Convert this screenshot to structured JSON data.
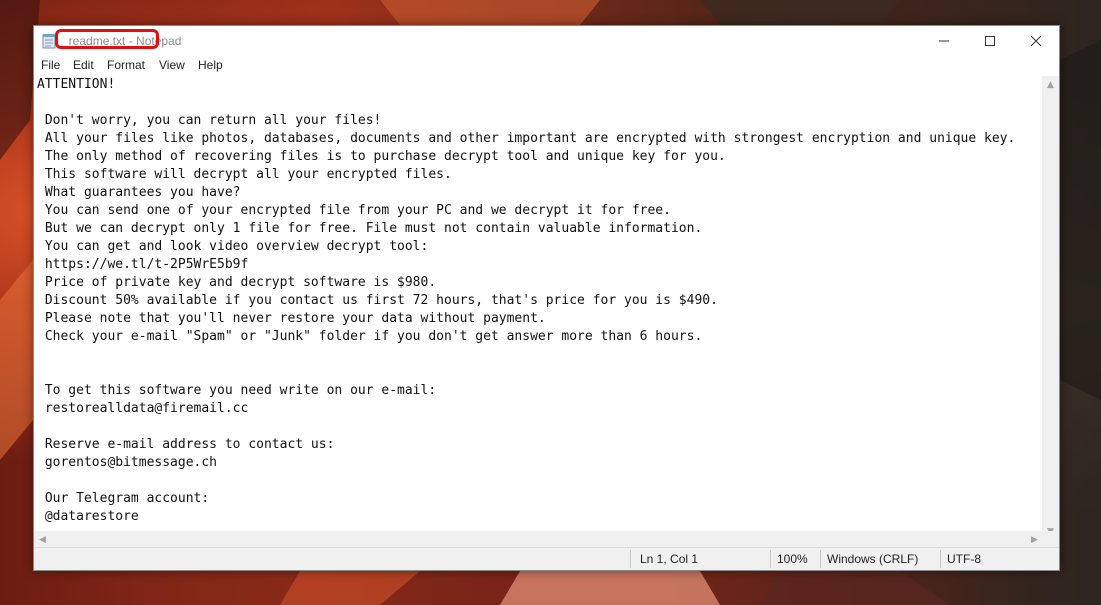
{
  "window": {
    "title": "_readme.txt - Notepad",
    "app_icon": "notepad-icon",
    "controls": [
      "minimize-icon",
      "maximize-icon",
      "close-icon"
    ]
  },
  "menu": {
    "items": [
      "File",
      "Edit",
      "Format",
      "View",
      "Help"
    ]
  },
  "document": {
    "text": "ATTENTION!\n\n Don't worry, you can return all your files!\n All your files like photos, databases, documents and other important are encrypted with strongest encryption and unique key.\n The only method of recovering files is to purchase decrypt tool and unique key for you.\n This software will decrypt all your encrypted files.\n What guarantees you have?\n You can send one of your encrypted file from your PC and we decrypt it for free.\n But we can decrypt only 1 file for free. File must not contain valuable information.\n You can get and look video overview decrypt tool:\n https://we.tl/t-2P5WrE5b9f\n Price of private key and decrypt software is $980.\n Discount 50% available if you contact us first 72 hours, that's price for you is $490.\n Please note that you'll never restore your data without payment.\n Check your e-mail \"Spam\" or \"Junk\" folder if you don't get answer more than 6 hours.\n\n\n To get this software you need write on our e-mail:\n restorealldata@firemail.cc\n\n Reserve e-mail address to contact us:\n gorentos@bitmessage.ch\n\n Our Telegram account:\n @datarestore"
  },
  "status": {
    "position": "Ln 1, Col 1",
    "zoom": "100%",
    "line_ending": "Windows (CRLF)",
    "encoding": "UTF-8"
  },
  "colors": {
    "highlight": "#e01010",
    "title_text": "#8d8d8d"
  }
}
